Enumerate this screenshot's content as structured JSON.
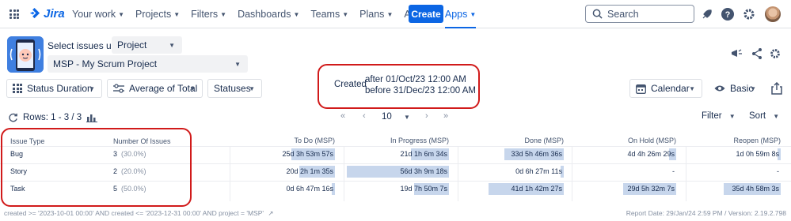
{
  "topnav": {
    "logo": "Jira",
    "items": [
      {
        "label": "Your work",
        "dropdown": true
      },
      {
        "label": "Projects",
        "dropdown": true
      },
      {
        "label": "Filters",
        "dropdown": true
      },
      {
        "label": "Dashboards",
        "dropdown": true
      },
      {
        "label": "Teams",
        "dropdown": true
      },
      {
        "label": "Plans",
        "dropdown": true
      },
      {
        "label": "Assets",
        "dropdown": false
      },
      {
        "label": "Apps",
        "dropdown": true,
        "active": true
      }
    ],
    "create_label": "Create",
    "search_placeholder": "Search",
    "accent": "#0c66e4"
  },
  "selector": {
    "label": "Select issues using",
    "mode_value": "Project",
    "project_value": "MSP - My Scrum Project"
  },
  "toolbar": {
    "status_duration": "Status Duration",
    "average": "Average of Total",
    "statuses": "Statuses",
    "calendar": "Calendar",
    "basic": "Basic"
  },
  "created_filter": {
    "label": "Created",
    "after": "after 01/Oct/23 12:00 AM",
    "before": "before 31/Dec/23 12:00 AM"
  },
  "rows_info": {
    "label": "Rows: 1 - 3 / 3",
    "page_size": "10",
    "filter": "Filter",
    "sort": "Sort"
  },
  "table": {
    "col_issue_type": "Issue Type",
    "col_number": "Number Of Issues",
    "status_columns": [
      "To Do (MSP)",
      "In Progress (MSP)",
      "Done (MSP)",
      "On Hold (MSP)",
      "Reopen (MSP)"
    ],
    "rows": [
      {
        "type": "Bug",
        "count": "3",
        "pct": "(30.0%)",
        "cells": [
          {
            "text": "25d 3h 53m 57s",
            "fill": 0.43
          },
          {
            "text": "21d 1h 6m 34s",
            "fill": 0.37
          },
          {
            "text": "33d 5h 46m 36s",
            "fill": 0.58
          },
          {
            "text": "4d 4h 26m 29s",
            "fill": 0.07
          },
          {
            "text": "1d 0h 59m 8s",
            "fill": 0.02
          }
        ]
      },
      {
        "type": "Story",
        "count": "2",
        "pct": "(20.0%)",
        "cells": [
          {
            "text": "20d 2h 1m 35s",
            "fill": 0.35
          },
          {
            "text": "56d 3h 9m 18s",
            "fill": 1.0
          },
          {
            "text": "0d 6h 27m 11s",
            "fill": 0.01
          },
          {
            "text": "-",
            "fill": 0
          },
          {
            "text": "-",
            "fill": 0
          }
        ]
      },
      {
        "type": "Task",
        "count": "5",
        "pct": "(50.0%)",
        "cells": [
          {
            "text": "0d 6h 47m 16s",
            "fill": 0.01
          },
          {
            "text": "19d 7h 50m 7s",
            "fill": 0.34
          },
          {
            "text": "41d 1h 42m 27s",
            "fill": 0.73
          },
          {
            "text": "29d 5h 32m 7s",
            "fill": 0.52
          },
          {
            "text": "35d 4h 58m 3s",
            "fill": 0.62
          }
        ]
      }
    ]
  },
  "footer": {
    "jql": "created >= '2023-10-01 00:00' AND created <= '2023-12-31 00:00' AND project = 'MSP'",
    "report_info": "Report Date: 29/Jan/24 2:59 PM / Version: 2.19.2.798"
  }
}
